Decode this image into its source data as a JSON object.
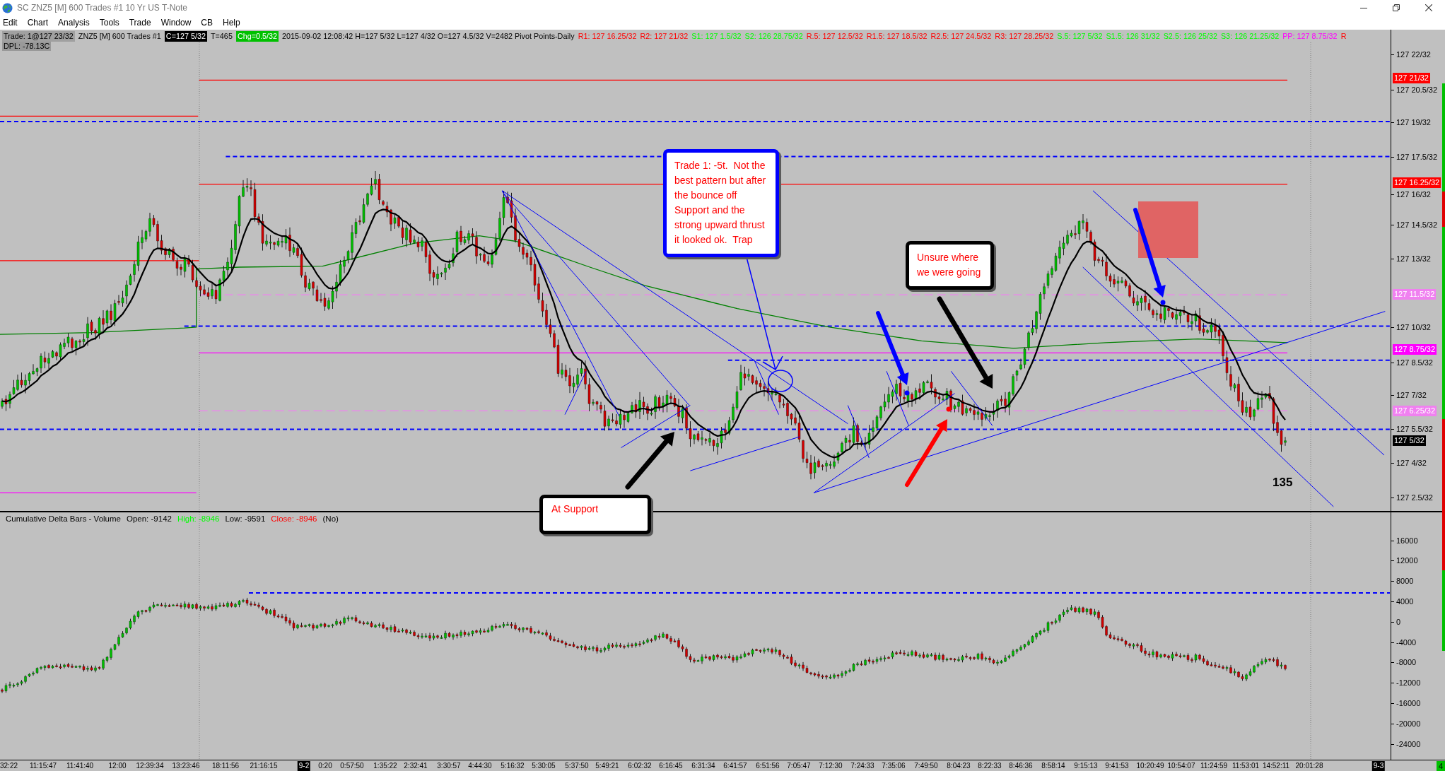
{
  "window": {
    "title": "SC ZNZ5 [M] 600 Trades #1 10 Yr US T-Note"
  },
  "menu": [
    "Edit",
    "Chart",
    "Analysis",
    "Tools",
    "Trade",
    "Window",
    "CB",
    "Help"
  ],
  "info_bar": {
    "items": [
      {
        "text": "Trade: 1@127 23/32",
        "kind": "shaded"
      },
      {
        "text": "ZNZ5 [M] 600 Trades #1",
        "kind": "plain"
      },
      {
        "text": "C=127 5/32",
        "kind": "dark"
      },
      {
        "text": "T=465",
        "kind": "plain"
      },
      {
        "text": "Chg=0.5/32",
        "kind": "up"
      },
      {
        "text": "2015-09-02 12:08:42 H=127 5/32 L=127 4/32 O=127 4.5/32 V=2482 Pivot Points-Daily",
        "kind": "plain"
      }
    ],
    "pivots": [
      {
        "text": "R1: 127 16.25/32",
        "color": "#ff0000"
      },
      {
        "text": "R2: 127 21/32",
        "color": "#ff0000"
      },
      {
        "text": "S1: 127 1.5/32",
        "color": "#00ff00"
      },
      {
        "text": "S2: 126 28.75/32",
        "color": "#00ff00"
      },
      {
        "text": "R.5: 127 12.5/32",
        "color": "#ff0000"
      },
      {
        "text": "R1.5: 127 18.5/32",
        "color": "#ff0000"
      },
      {
        "text": "R2.5: 127 24.5/32",
        "color": "#ff0000"
      },
      {
        "text": "R3: 127 28.25/32",
        "color": "#ff0000"
      },
      {
        "text": "S.5: 127 5/32",
        "color": "#00ff00"
      },
      {
        "text": "S1.5: 126 31/32",
        "color": "#00ff00"
      },
      {
        "text": "S2.5: 126 25/32",
        "color": "#00ff00"
      },
      {
        "text": "S3: 126 21.25/32",
        "color": "#00ff00"
      },
      {
        "text": "PP: 127 8.75/32",
        "color": "#ff00ff"
      },
      {
        "text": "R",
        "color": "#ff0000"
      }
    ],
    "dpl": "DPL: -78.13C"
  },
  "price_pane": {
    "axis_labels": [
      "127 22/32",
      "127 20.5/32",
      "127 19/32",
      "127 17.5/32",
      "127 16/32",
      "127 14.5/32",
      "127 13/32",
      "127 10/32",
      "127 8.5/32",
      "127 7/32",
      "127 5.5/32",
      "127 4/32",
      "127 2.5/32"
    ],
    "axis_markers": [
      {
        "text": "127 21/32",
        "color": "#ff0000"
      },
      {
        "text": "127 16.25/32",
        "color": "#ff0000"
      },
      {
        "text": "127 11.5/32",
        "color": "#f080f0"
      },
      {
        "text": "127 8.75/32",
        "color": "#ff00ff"
      },
      {
        "text": "127 6.25/32",
        "color": "#f080f0"
      },
      {
        "text": "127 5/32",
        "color": "#000000"
      }
    ],
    "annotations": [
      {
        "text": "Trade 1: -5t.  Not the\nbest pattern but after\nthe bounce off\nSupport and the\nstrong upward thrust\nit looked ok.  Trap",
        "color": "#0000ff"
      },
      {
        "text": "Unsure where\nwe were going",
        "color": "#000000"
      },
      {
        "text": "At Support",
        "color": "#000000"
      }
    ],
    "bar_count": "135"
  },
  "delta_pane": {
    "title": "Cumulative Delta Bars - Volume",
    "stats": [
      {
        "text": "Open: -9142",
        "color": "#000000"
      },
      {
        "text": "High: -8946",
        "color": "#00ff00"
      },
      {
        "text": "Low: -9591",
        "color": "#000000"
      },
      {
        "text": "Close: -8946",
        "color": "#ff0000"
      },
      {
        "text": "(No)",
        "color": "#000000"
      }
    ],
    "axis_labels": [
      "16000",
      "12000",
      "8000",
      "4000",
      "0",
      "-4000",
      "-8000",
      "-12000",
      "-16000",
      "-20000",
      "-24000"
    ]
  },
  "time_axis": {
    "labels": [
      {
        "text": "32:22",
        "kind": "time"
      },
      {
        "text": "11:15:47",
        "kind": "time"
      },
      {
        "text": "11:41:40",
        "kind": "time"
      },
      {
        "text": "12:00",
        "kind": "time"
      },
      {
        "text": "12:39:34",
        "kind": "time"
      },
      {
        "text": "13:23:46",
        "kind": "time"
      },
      {
        "text": "18:11:56",
        "kind": "time"
      },
      {
        "text": "21:16:15",
        "kind": "time"
      },
      {
        "text": "9-2",
        "kind": "date"
      },
      {
        "text": "0:20",
        "kind": "time"
      },
      {
        "text": "0:57:50",
        "kind": "time"
      },
      {
        "text": "1:35:22",
        "kind": "time"
      },
      {
        "text": "2:32:41",
        "kind": "time"
      },
      {
        "text": "3:30:57",
        "kind": "time"
      },
      {
        "text": "4:44:30",
        "kind": "time"
      },
      {
        "text": "5:16:32",
        "kind": "time"
      },
      {
        "text": "5:30:05",
        "kind": "time"
      },
      {
        "text": "5:37:50",
        "kind": "time"
      },
      {
        "text": "5:49:21",
        "kind": "time"
      },
      {
        "text": "6:02:32",
        "kind": "time"
      },
      {
        "text": "6:16:45",
        "kind": "time"
      },
      {
        "text": "6:31:34",
        "kind": "time"
      },
      {
        "text": "6:41:57",
        "kind": "time"
      },
      {
        "text": "6:51:56",
        "kind": "time"
      },
      {
        "text": "7:05:47",
        "kind": "time"
      },
      {
        "text": "7:12:30",
        "kind": "time"
      },
      {
        "text": "7:24:33",
        "kind": "time"
      },
      {
        "text": "7:35:06",
        "kind": "time"
      },
      {
        "text": "7:49:50",
        "kind": "time"
      },
      {
        "text": "8:04:23",
        "kind": "time"
      },
      {
        "text": "8:22:33",
        "kind": "time"
      },
      {
        "text": "8:46:36",
        "kind": "time"
      },
      {
        "text": "8:58:14",
        "kind": "time"
      },
      {
        "text": "9:15:13",
        "kind": "time"
      },
      {
        "text": "9:41:53",
        "kind": "time"
      },
      {
        "text": "10:20:49",
        "kind": "time"
      },
      {
        "text": "10:54:07",
        "kind": "time"
      },
      {
        "text": "11:24:59",
        "kind": "time"
      },
      {
        "text": "11:53:01",
        "kind": "time"
      },
      {
        "text": "14:52:11",
        "kind": "time"
      },
      {
        "text": "20:01:28",
        "kind": "time"
      },
      {
        "text": "9-3",
        "kind": "date"
      }
    ]
  },
  "corner_badge": "4"
}
